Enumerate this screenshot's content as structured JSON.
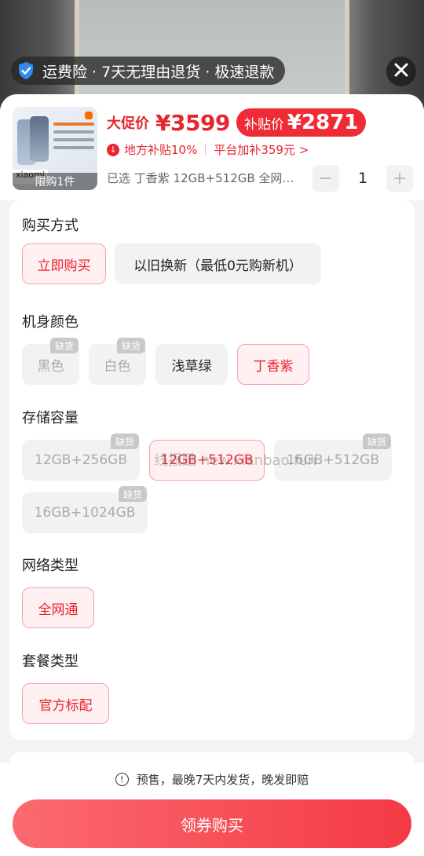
{
  "insurance_bar": {
    "text": "运费险 · 7天无理由退货 · 极速退款",
    "icon": "shield-check-icon"
  },
  "close_icon": "close-icon",
  "product": {
    "thumb_brand": "xiaomi",
    "limit_badge": "限购1件",
    "promo_label": "大促价",
    "promo_price": "¥3599",
    "subsidy_label": "补贴价",
    "subsidy_price": "¥2871",
    "local_subsidy": "地方补贴10%",
    "platform_subsidy": "平台加补359元 >",
    "selected_text": "已选 丁香紫 12GB+512GB 全网…",
    "quantity": "1",
    "minus": "−",
    "plus": "+"
  },
  "sections": {
    "purchase": {
      "title": "购买方式",
      "options": [
        "立即购买",
        "以旧换新（最低0元购新机）"
      ],
      "selected": "立即购买"
    },
    "color": {
      "title": "机身颜色",
      "options": [
        "黑色",
        "白色",
        "浅草绿",
        "丁香紫"
      ],
      "out_of_stock": [
        "黑色",
        "白色"
      ],
      "selected": "丁香紫"
    },
    "storage": {
      "title": "存储容量",
      "options": [
        "12GB+256GB",
        "12GB+512GB",
        "16GB+512GB",
        "16GB+1024GB"
      ],
      "out_of_stock": [
        "12GB+256GB",
        "16GB+512GB",
        "16GB+1024GB"
      ],
      "selected": "12GB+512GB"
    },
    "network": {
      "title": "网络类型",
      "options": [
        "全网通"
      ],
      "selected": "全网通"
    },
    "package": {
      "title": "套餐类型",
      "options": [
        "官方标配"
      ],
      "selected": "官方标配"
    }
  },
  "oos_label": "缺货",
  "watermark": "线报酷 new.xianbao.fun",
  "footer": {
    "notice": "预售，最晚7天内发货，晚发即赔",
    "buy_button": "领券购买"
  },
  "colors": {
    "accent": "#e8242f",
    "selected_bg": "#fff1f1",
    "chip_bg": "#f2f2f2"
  }
}
